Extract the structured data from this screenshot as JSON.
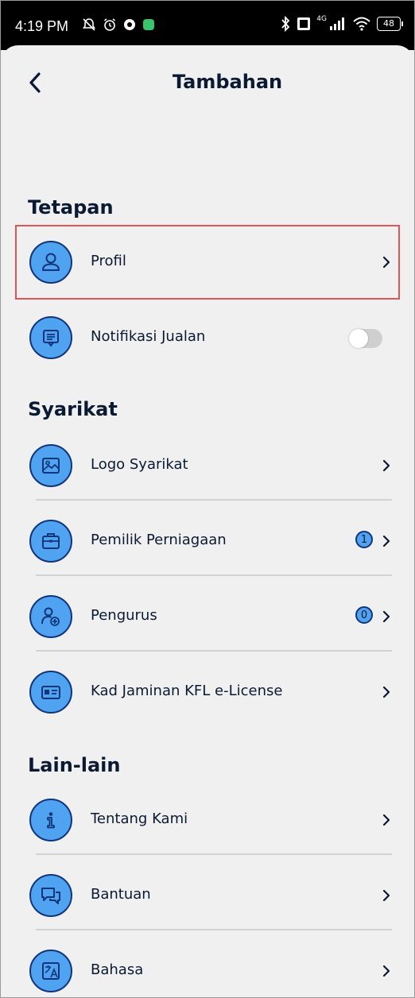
{
  "status_bar": {
    "time": "4:19 PM",
    "network": "4G",
    "battery": "48"
  },
  "header": {
    "title": "Tambahan",
    "back_icon": "chevron-left-icon"
  },
  "sections": {
    "tetapan": {
      "title": "Tetapan",
      "items": [
        {
          "label": "Profil",
          "icon": "user-icon",
          "highlighted": true
        },
        {
          "label": "Notifikasi Jualan",
          "icon": "message-icon",
          "toggle_on": false
        }
      ]
    },
    "syarikat": {
      "title": "Syarikat",
      "items": [
        {
          "label": "Logo Syarikat",
          "icon": "image-icon"
        },
        {
          "label": "Pemilik Perniagaan",
          "icon": "briefcase-icon",
          "count": "1"
        },
        {
          "label": "Pengurus",
          "icon": "user-add-icon",
          "count": "0"
        },
        {
          "label": "Kad Jaminan KFL e-License",
          "icon": "id-card-icon"
        }
      ]
    },
    "lain_lain": {
      "title": "Lain-lain",
      "items": [
        {
          "label": "Tentang Kami",
          "icon": "info-icon"
        },
        {
          "label": "Bantuan",
          "icon": "chat-icon"
        },
        {
          "label": "Bahasa",
          "icon": "translate-icon"
        }
      ]
    }
  },
  "colors": {
    "icon_fill": "#4fa3f0",
    "icon_stroke": "#12357a",
    "text": "#0b1a33",
    "background": "#f0f0f0",
    "highlight_border": "#e05555"
  }
}
